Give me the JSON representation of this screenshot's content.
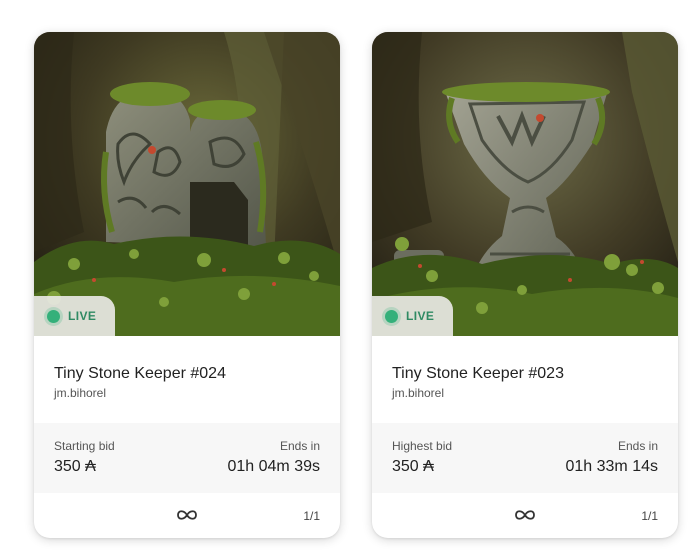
{
  "cards": [
    {
      "status_label": "LIVE",
      "title": "Tiny Stone Keeper #024",
      "creator": "jm.bihorel",
      "bid_label": "Starting bid",
      "bid_value": "350 ₳",
      "ends_label": "Ends in",
      "ends_value": "01h 04m 39s",
      "edition": "1/1",
      "artwork_icon": "stone-keeper-rounded-artwork",
      "footer_icon": "infinity-icon"
    },
    {
      "status_label": "LIVE",
      "title": "Tiny Stone Keeper #023",
      "creator": "jm.bihorel",
      "bid_label": "Highest bid",
      "bid_value": "350 ₳",
      "ends_label": "Ends in",
      "ends_value": "01h 33m 14s",
      "edition": "1/1",
      "artwork_icon": "stone-keeper-hourglass-artwork",
      "footer_icon": "infinity-icon"
    }
  ],
  "colors": {
    "live_accent": "#34b07a",
    "live_text": "#2f8a63",
    "card_background": "#ffffff",
    "bid_row_background": "#f7f7f7"
  }
}
